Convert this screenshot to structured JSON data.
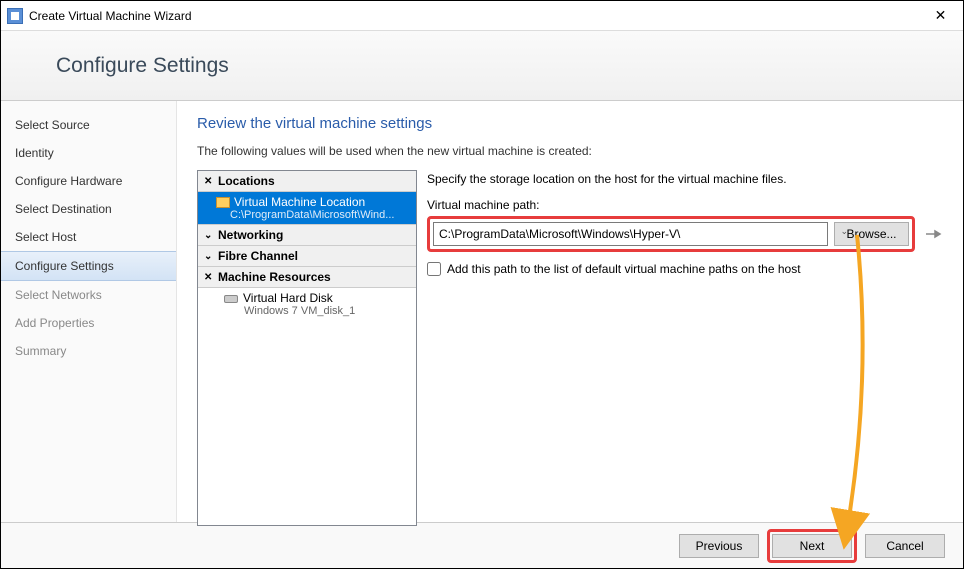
{
  "window": {
    "title": "Create Virtual Machine Wizard"
  },
  "header": {
    "title": "Configure Settings"
  },
  "sidebar": {
    "items": [
      {
        "label": "Select Source",
        "state": ""
      },
      {
        "label": "Identity",
        "state": ""
      },
      {
        "label": "Configure Hardware",
        "state": ""
      },
      {
        "label": "Select Destination",
        "state": ""
      },
      {
        "label": "Select Host",
        "state": ""
      },
      {
        "label": "Configure Settings",
        "state": "active"
      },
      {
        "label": "Select Networks",
        "state": "disabled"
      },
      {
        "label": "Add Properties",
        "state": "disabled"
      },
      {
        "label": "Summary",
        "state": "disabled"
      }
    ]
  },
  "content": {
    "heading": "Review the virtual machine settings",
    "lead": "The following values will be used when the new virtual machine is created:"
  },
  "tree": {
    "locations_header": "Locations",
    "vm_location_label": "Virtual Machine Location",
    "vm_location_path": "C:\\ProgramData\\Microsoft\\Wind...",
    "networking_header": "Networking",
    "fibre_header": "Fibre Channel",
    "resources_header": "Machine Resources",
    "vhd_label": "Virtual Hard Disk",
    "vhd_sub": "Windows 7 VM_disk_1"
  },
  "details": {
    "desc": "Specify the storage location on the host for the virtual machine files.",
    "path_label": "Virtual machine path:",
    "path_value": "C:\\ProgramData\\Microsoft\\Windows\\Hyper-V\\",
    "browse": "Browse...",
    "checkbox": "Add this path to the list of default virtual machine paths on the host"
  },
  "footer": {
    "previous": "Previous",
    "next": "Next",
    "cancel": "Cancel"
  }
}
